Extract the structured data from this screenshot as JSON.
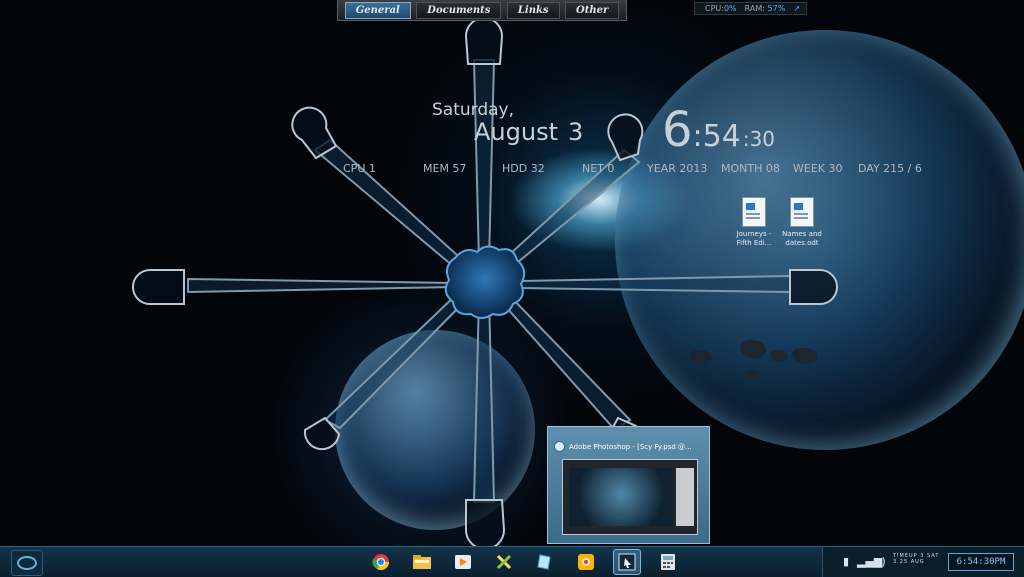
{
  "top_menu": {
    "tabs": [
      {
        "label": "General",
        "active": true
      },
      {
        "label": "Documents",
        "active": false
      },
      {
        "label": "Links",
        "active": false
      },
      {
        "label": "Other",
        "active": false
      }
    ]
  },
  "system_monitor": {
    "cpu_label": "CPU:",
    "cpu_value": "0%",
    "ram_label": "RAM:",
    "ram_value": "57%",
    "arrow": "↗"
  },
  "date": {
    "day_of_week": "Saturday,",
    "month": "August",
    "day": "3"
  },
  "clock": {
    "hour": "6",
    "minute": ":54",
    "second": ":30"
  },
  "stats": {
    "cpu": "CPU 1",
    "mem": "MEM 57",
    "hdd": "HDD 32",
    "net": "NET 0",
    "year": "YEAR 2013",
    "month": "MONTH 08",
    "week": "WEEK 30",
    "day": "DAY 215  / 6"
  },
  "desktop_icons": [
    {
      "label_line1": "Journeys -",
      "label_line2": "Fifth Edi..."
    },
    {
      "label_line1": "Names and",
      "label_line2": "dates.odt"
    }
  ],
  "taskbar_preview": {
    "title": "Adobe Photoshop - [Scy Fy.psd @..."
  },
  "taskbar": {
    "apps": [
      {
        "name": "chrome-icon"
      },
      {
        "name": "file-explorer-icon"
      },
      {
        "name": "media-player-icon"
      },
      {
        "name": "tools-icon"
      },
      {
        "name": "document-app-icon"
      },
      {
        "name": "paint-app-icon"
      },
      {
        "name": "photoshop-icon",
        "active": true
      },
      {
        "name": "calculator-icon"
      }
    ]
  },
  "tray": {
    "small_text_line1": "TIMEUP 3 SAT",
    "small_text_line2": "3.25     AUG",
    "digital_clock": "6:54:30PM"
  },
  "colors": {
    "accent": "#4fb3ff",
    "taskbar": "#0a1f2d"
  }
}
